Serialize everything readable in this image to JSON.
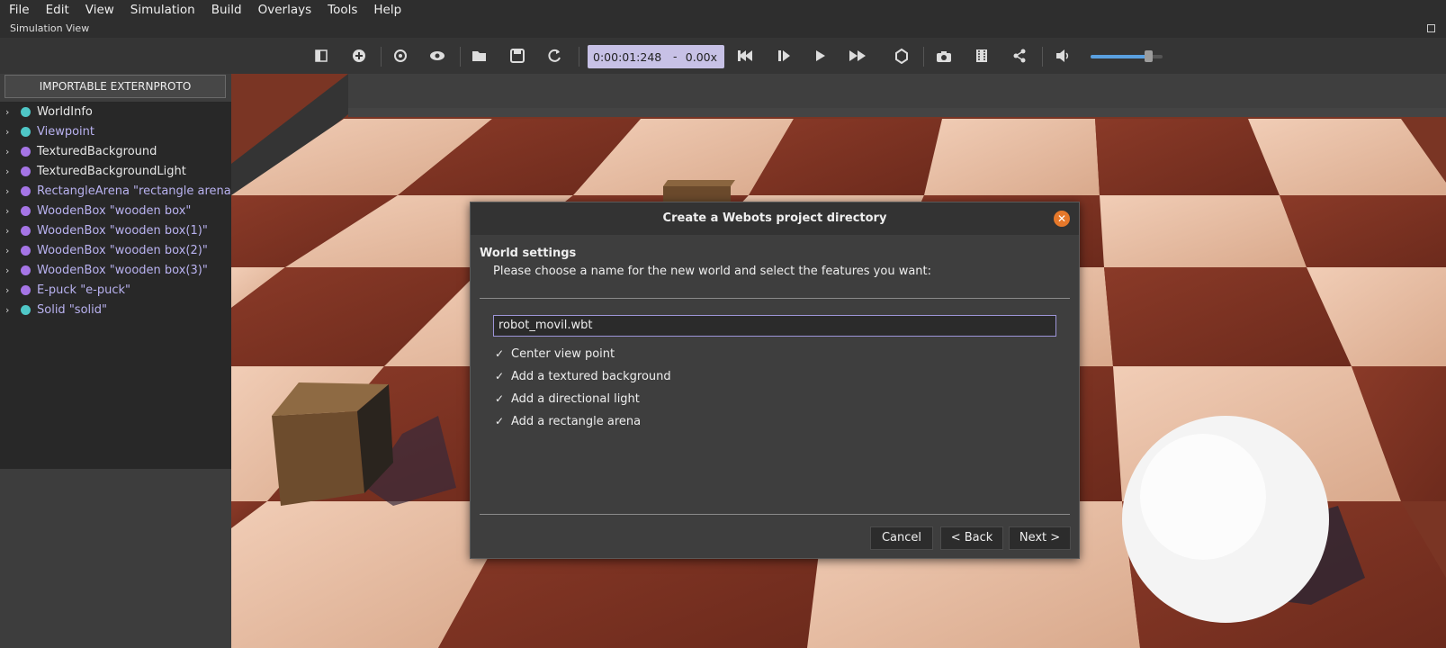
{
  "menu": [
    "File",
    "Edit",
    "View",
    "Simulation",
    "Build",
    "Overlays",
    "Tools",
    "Help"
  ],
  "sim_view_title": "Simulation View",
  "toolbar": {
    "time": "0:00:01:248",
    "dash": "-",
    "speed": "0.00x",
    "volume_level": 0.78,
    "accent": "#c7c1e6"
  },
  "left": {
    "externproto_button": "IMPORTABLE EXTERNPROTO",
    "tree": [
      {
        "label": "WorldInfo",
        "color": "#4fc7c7",
        "text_color": "#e8e8e8"
      },
      {
        "label": "Viewpoint",
        "color": "#4fc7c7",
        "text_color": "#b9b2f0"
      },
      {
        "label": "TexturedBackground",
        "color": "#a575e6",
        "text_color": "#e8e8e8"
      },
      {
        "label": "TexturedBackgroundLight",
        "color": "#a575e6",
        "text_color": "#e8e8e8"
      },
      {
        "label": "RectangleArena \"rectangle arena\"",
        "color": "#a575e6",
        "text_color": "#b9b2f0"
      },
      {
        "label": "WoodenBox \"wooden box\"",
        "color": "#a575e6",
        "text_color": "#b9b2f0"
      },
      {
        "label": "WoodenBox \"wooden box(1)\"",
        "color": "#a575e6",
        "text_color": "#b9b2f0"
      },
      {
        "label": "WoodenBox \"wooden box(2)\"",
        "color": "#a575e6",
        "text_color": "#b9b2f0"
      },
      {
        "label": "WoodenBox \"wooden box(3)\"",
        "color": "#a575e6",
        "text_color": "#b9b2f0"
      },
      {
        "label": "E-puck \"e-puck\"",
        "color": "#a575e6",
        "text_color": "#b9b2f0"
      },
      {
        "label": "Solid \"solid\"",
        "color": "#4fc7c7",
        "text_color": "#b9b2f0"
      }
    ]
  },
  "dialog": {
    "title": "Create a Webots project directory",
    "heading": "World settings",
    "description": "Please choose a name for the new world and select the features you want:",
    "world_name": "robot_movil.wbt",
    "options": [
      {
        "label": "Center view point",
        "checked": true
      },
      {
        "label": "Add a textured background",
        "checked": true
      },
      {
        "label": "Add a directional light",
        "checked": true
      },
      {
        "label": "Add a rectangle arena",
        "checked": true
      }
    ],
    "cancel": "Cancel",
    "back": "< Back",
    "next": "Next >"
  }
}
